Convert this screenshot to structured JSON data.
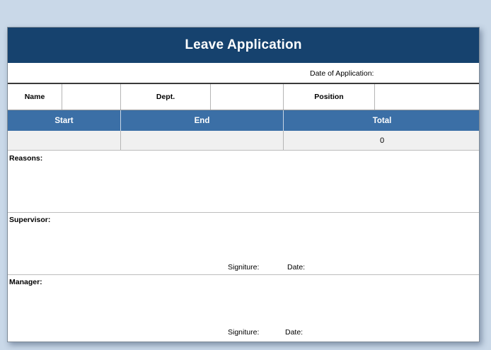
{
  "title": "Leave Application",
  "date_of_application_label": "Date of Application:",
  "fields": {
    "name_label": "Name",
    "dept_label": "Dept.",
    "position_label": "Position"
  },
  "period_table": {
    "headers": [
      "Start",
      "End",
      "Total"
    ],
    "values": [
      "",
      "",
      "0"
    ]
  },
  "reasons": {
    "label": "Reasons:"
  },
  "supervisor": {
    "label": "Supervisor:",
    "signature_label": "Signiture:",
    "date_label": "Date:"
  },
  "manager": {
    "label": "Manager:",
    "signature_label": "Signiture:",
    "date_label": "Date:"
  }
}
